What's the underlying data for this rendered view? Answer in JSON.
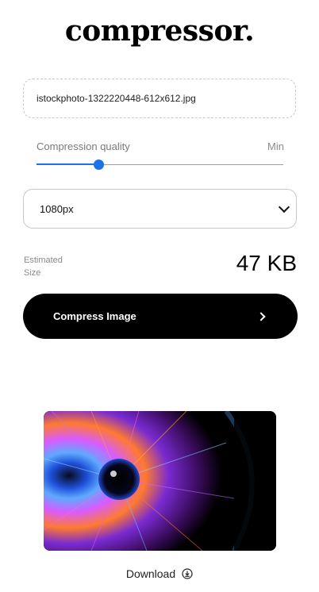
{
  "app": {
    "logo": "compressor."
  },
  "file": {
    "name": "istockphoto-1322220448-612x612.jpg"
  },
  "quality": {
    "label": "Compression quality",
    "min_label": "Min",
    "value_fraction": 0.25
  },
  "size_select": {
    "selected": "1080px"
  },
  "estimate": {
    "label_line1": "Estimated",
    "label_line2": "Size",
    "value": "47 KB"
  },
  "compress_button": {
    "label": "Compress Image",
    "icon": "chevron-right-icon"
  },
  "preview": {
    "image": "colorful-eye-fiber-optic-image"
  },
  "download": {
    "label": "Download",
    "icon": "download-circle-icon"
  },
  "colors": {
    "accent": "#1a73e8",
    "button_bg": "#000000"
  }
}
